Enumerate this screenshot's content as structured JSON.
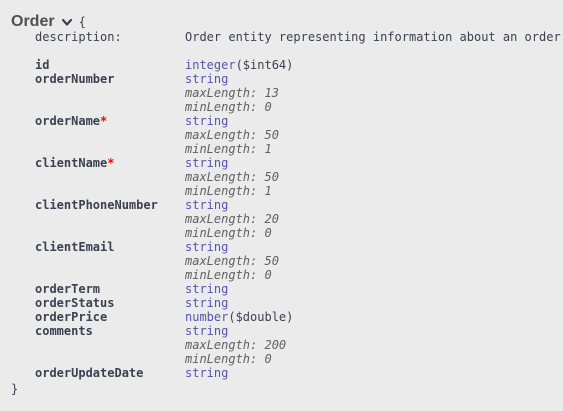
{
  "model": {
    "title": "Order",
    "brace_open": "{",
    "brace_close": "}",
    "description_label": "description:",
    "description_value": "Order entity representing information about an order"
  },
  "properties": [
    {
      "name": "id",
      "required": false,
      "type": "integer",
      "format": "($int64)"
    },
    {
      "name": "orderNumber",
      "required": false,
      "type": "string",
      "constraints": [
        "maxLength: 13",
        "minLength: 0"
      ]
    },
    {
      "name": "orderName",
      "required": true,
      "required_mark": "*",
      "type": "string",
      "constraints": [
        "maxLength: 50",
        "minLength: 1"
      ]
    },
    {
      "name": "clientName",
      "required": true,
      "required_mark": "*",
      "type": "string",
      "constraints": [
        "maxLength: 50",
        "minLength: 1"
      ]
    },
    {
      "name": "clientPhoneNumber",
      "required": false,
      "type": "string",
      "constraints": [
        "maxLength: 20",
        "minLength: 0"
      ]
    },
    {
      "name": "clientEmail",
      "required": false,
      "type": "string",
      "constraints": [
        "maxLength: 50",
        "minLength: 0"
      ]
    },
    {
      "name": "orderTerm",
      "required": false,
      "type": "string"
    },
    {
      "name": "orderStatus",
      "required": false,
      "type": "string"
    },
    {
      "name": "orderPrice",
      "required": false,
      "type": "number",
      "format": "($double)"
    },
    {
      "name": "comments",
      "required": false,
      "type": "string",
      "constraints": [
        "maxLength: 200",
        "minLength: 0"
      ]
    },
    {
      "name": "orderUpdateDate",
      "required": false,
      "type": "string"
    }
  ],
  "icons": {
    "toggle": "chevron-down-icon"
  },
  "colors": {
    "background": "#ebebeb",
    "text": "#3b4151",
    "type": "#55aa",
    "required": "#ff0000"
  }
}
